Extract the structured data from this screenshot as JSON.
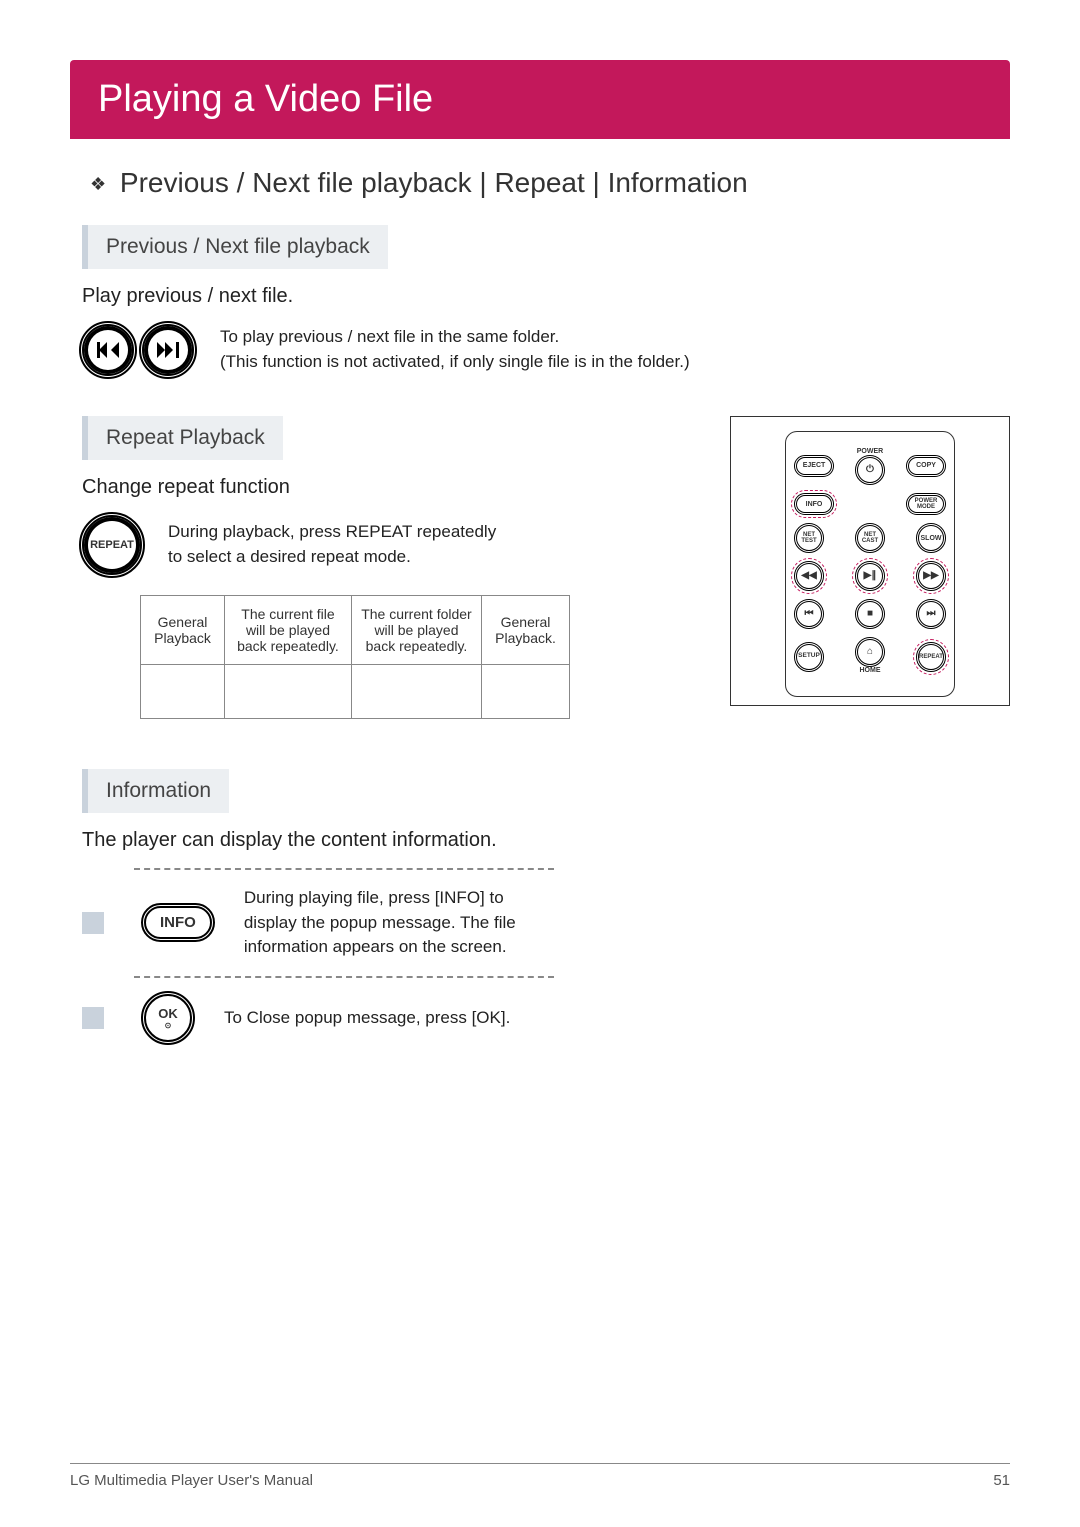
{
  "title": "Playing a Video File",
  "section_title": "Previous / Next ﬁle playback | Repeat | Information",
  "prevnext": {
    "heading": "Previous / Next ﬁle playback",
    "lead": "Play previous / next file.",
    "desc1": "To play previous / next ﬁle in the same folder.",
    "desc2": "(This function is not activated, if only single ﬁle is in the folder.)"
  },
  "repeat": {
    "heading": "Repeat Playback",
    "lead": "Change repeat function",
    "btn_label": "REPEAT",
    "desc": "During playback, press REPEAT repeatedly to select a desired repeat mode.",
    "table": {
      "c1": "General Playback",
      "c2": "The current ﬁle will be played back repeatedly.",
      "c3": "The current folder will be played back repeatedly.",
      "c4": "General Playback."
    }
  },
  "remote": {
    "power": "POWER",
    "eject": "EJECT",
    "copy": "COPY",
    "info": "INFO",
    "power_mode": "POWER MODE",
    "net_test": "NET TEST",
    "net_cast": "NET CAST",
    "slow": "SLOW",
    "setup": "SETUP",
    "home": "HOME",
    "repeat": "REPEAT"
  },
  "info": {
    "heading": "Information",
    "lead": "The player can display the content information.",
    "btn1": "INFO",
    "desc1": "During playing ﬁle, press [INFO] to display the popup message. The ﬁle information appears on the screen.",
    "btn2": "OK",
    "desc2": "To Close popup message, press [OK]."
  },
  "footer": {
    "left": "LG Multimedia Player User's Manual",
    "right": "51"
  }
}
